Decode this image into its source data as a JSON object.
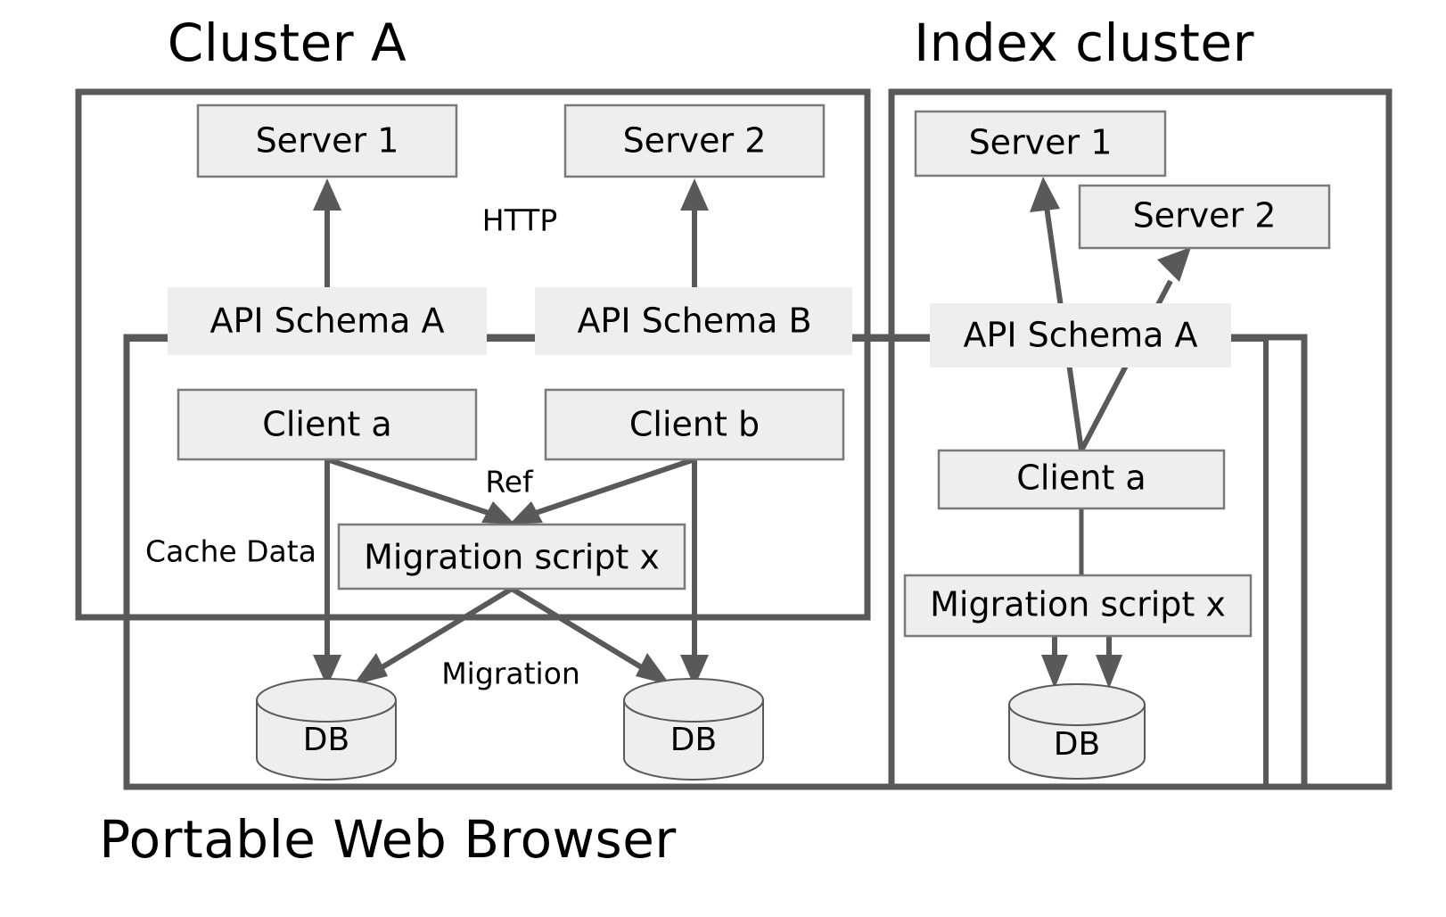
{
  "titles": {
    "cluster_a": "Cluster A",
    "index_cluster": "Index cluster",
    "portable_web_browser": "Portable Web Browser"
  },
  "edge_labels": {
    "http": "HTTP",
    "ref": "Ref",
    "cache_data": "Cache Data",
    "migration": "Migration"
  },
  "cluster_a": {
    "server1": "Server 1",
    "server2": "Server 2",
    "api_schema_a": "API Schema A",
    "api_schema_b": "API Schema B",
    "client_a": "Client a",
    "client_b": "Client b",
    "migration_script": "Migration script x",
    "db_left": "DB",
    "db_right": "DB"
  },
  "index_cluster": {
    "server1": "Server 1",
    "server2": "Server 2",
    "api_schema_a": "API Schema A",
    "client_a": "Client a",
    "migration_script": "Migration script x",
    "db": "DB"
  },
  "colors": {
    "frame_stroke": "#595959",
    "node_fill": "#eeeeee",
    "node_stroke": "#7a7a7a",
    "connector": "#595959",
    "text": "#000000",
    "background": "#ffffff"
  }
}
